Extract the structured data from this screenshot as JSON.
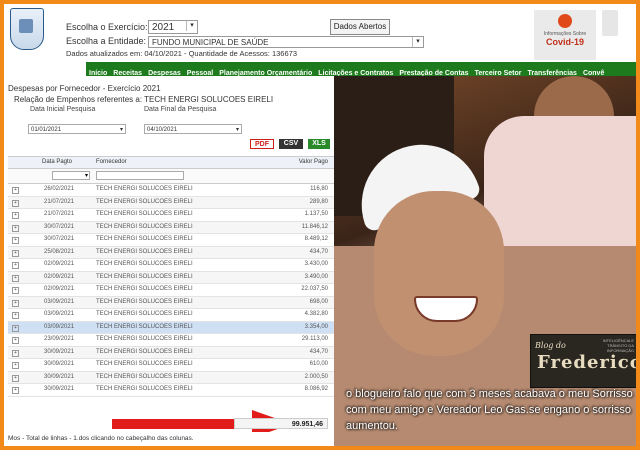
{
  "header": {
    "exercicio_label": "Escolha o Exercício:",
    "exercicio_value": "2021",
    "entidade_label": "Escolha a Entidade:",
    "entidade_value": "FUNDO MUNICIPAL DE SAÚDE",
    "dados_abertos": "Dados Abertos",
    "info": "Dados atualizados em: 04/10/2021 - Quantidade de Acessos: 136673",
    "covid_small": "Informações Sobre",
    "covid_label": "Covid-19"
  },
  "nav": [
    "Início",
    "Receitas",
    "Despesas",
    "Pessoal",
    "Planejamento Orçamentário",
    "Licitações e Contratos",
    "Prestação de Contas",
    "Terceiro Setor",
    "Transferências",
    "Convê"
  ],
  "panel": {
    "title": "Despesas por Fornecedor - Exercício 2021",
    "subtitle": "Relação de Empenhos referentes a: TECH ENERGI SOLUCOES EIRELI",
    "data_inicial_label": "Data Inicial Pesquisa",
    "data_final_label": "Data Final da Pesquisa",
    "data_inicial": "01/01/2021",
    "data_final": "04/10/2021",
    "pdf": "PDF",
    "csv": "CSV",
    "xls": "XLS"
  },
  "grid": {
    "columns": [
      "Data Pagto",
      "Fornecedor",
      "Valor Pago"
    ],
    "rows": [
      {
        "data": "26/02/2021",
        "fornecedor": "TECH ENERGI SOLUCOES EIRELI",
        "valor": "116,80"
      },
      {
        "data": "21/07/2021",
        "fornecedor": "TECH ENERGI SOLUCOES EIRELI",
        "valor": "289,80"
      },
      {
        "data": "21/07/2021",
        "fornecedor": "TECH ENERGI SOLUCOES EIRELI",
        "valor": "1.137,50"
      },
      {
        "data": "30/07/2021",
        "fornecedor": "TECH ENERGI SOLUCOES EIRELI",
        "valor": "11.846,12"
      },
      {
        "data": "30/07/2021",
        "fornecedor": "TECH ENERGI SOLUCOES EIRELI",
        "valor": "8.489,12"
      },
      {
        "data": "25/08/2021",
        "fornecedor": "TECH ENERGI SOLUCOES EIRELI",
        "valor": "434,70"
      },
      {
        "data": "02/09/2021",
        "fornecedor": "TECH ENERGI SOLUCOES EIRELI",
        "valor": "3.430,00"
      },
      {
        "data": "02/09/2021",
        "fornecedor": "TECH ENERGI SOLUCOES EIRELI",
        "valor": "3.490,00"
      },
      {
        "data": "02/09/2021",
        "fornecedor": "TECH ENERGI SOLUCOES EIRELI",
        "valor": "22.037,50"
      },
      {
        "data": "03/09/2021",
        "fornecedor": "TECH ENERGI SOLUCOES EIRELI",
        "valor": "698,00"
      },
      {
        "data": "03/09/2021",
        "fornecedor": "TECH ENERGI SOLUCOES EIRELI",
        "valor": "4.382,80"
      },
      {
        "data": "03/09/2021",
        "fornecedor": "TECH ENERGI SOLUCOES EIRELI",
        "valor": "3.354,00"
      },
      {
        "data": "23/09/2021",
        "fornecedor": "TECH ENERGI SOLUCOES EIRELI",
        "valor": "29.113,00"
      },
      {
        "data": "30/09/2021",
        "fornecedor": "TECH ENERGI SOLUCOES EIRELI",
        "valor": "434,70"
      },
      {
        "data": "30/09/2021",
        "fornecedor": "TECH ENERGI SOLUCOES EIRELI",
        "valor": "610,00"
      },
      {
        "data": "30/09/2021",
        "fornecedor": "TECH ENERGI SOLUCOES EIRELI",
        "valor": "2.000,50"
      },
      {
        "data": "30/09/2021",
        "fornecedor": "TECH ENERGI SOLUCOES EIRELI",
        "valor": "8.086,92"
      }
    ],
    "highlighted_row": 11,
    "total": "99.951,46"
  },
  "footer": "Mos - Total de linhas - 1.dos clicando no cabeçalho das colunas.",
  "photo": {
    "caption": "o blogueiro falo que com 3 meses acabava o meu Sorrisso com meu amigo e Vereador Leo Gas.se engano o sorrisso aumentou.",
    "logo_top": "Blog do",
    "logo_main": "Frederico",
    "logo_small": "INTELIGÊNCIA E TRÂNSITO DA INFORMAÇÃO",
    "colors": {
      "caption": "#ffffff",
      "frame": "#f28a1a"
    }
  }
}
